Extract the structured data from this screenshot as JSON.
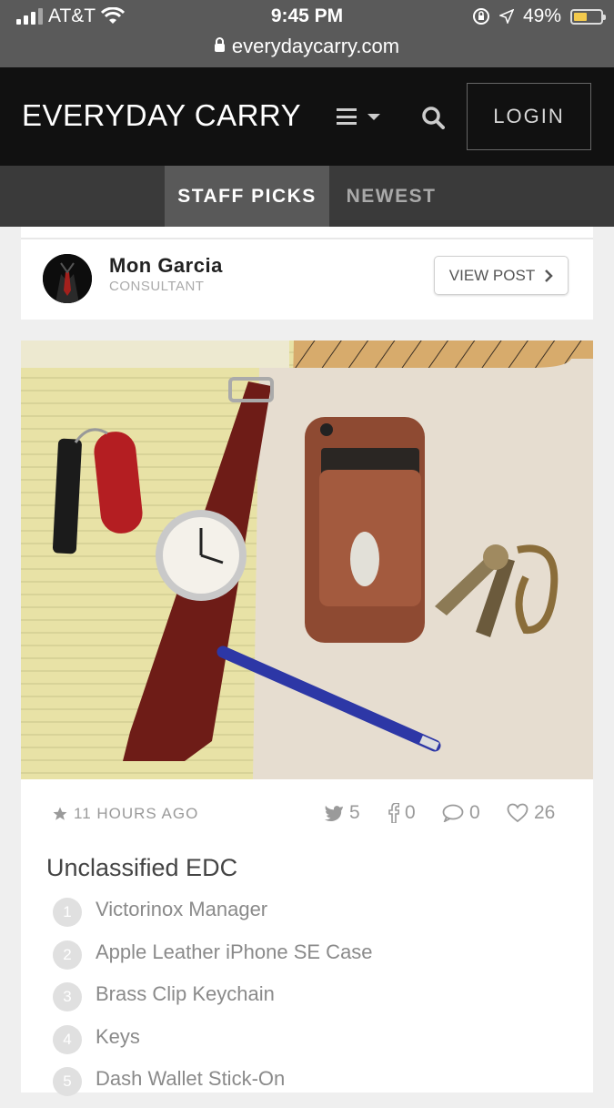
{
  "status_bar": {
    "carrier": "AT&T",
    "time": "9:45 PM",
    "battery": "49%",
    "battery_level": 0.49,
    "url": "everydaycarry.com"
  },
  "header": {
    "logo": "EVERYDAY CARRY",
    "login_label": "LOGIN"
  },
  "tabs": [
    {
      "label": "STAFF PICKS",
      "active": true
    },
    {
      "label": "NEWEST",
      "active": false
    }
  ],
  "author": {
    "name": "Mon Garcia",
    "role": "CONSULTANT",
    "view_post_label": "VIEW POST"
  },
  "post": {
    "time_ago": "11 HOURS AGO",
    "stats": {
      "twitter": "5",
      "facebook": "0",
      "comments": "0",
      "likes": "26"
    },
    "title": "Unclassified EDC",
    "items": [
      {
        "num": "1",
        "label": "Victorinox Manager"
      },
      {
        "num": "2",
        "label": "Apple Leather iPhone SE Case"
      },
      {
        "num": "3",
        "label": "Brass Clip Keychain"
      },
      {
        "num": "4",
        "label": "Keys"
      },
      {
        "num": "5",
        "label": "Dash Wallet Stick-On"
      }
    ]
  },
  "colors": {
    "header_bg": "#111111",
    "tabs_bg": "#3a3a3a",
    "active_tab_bg": "#595959",
    "page_bg": "#efefef"
  }
}
